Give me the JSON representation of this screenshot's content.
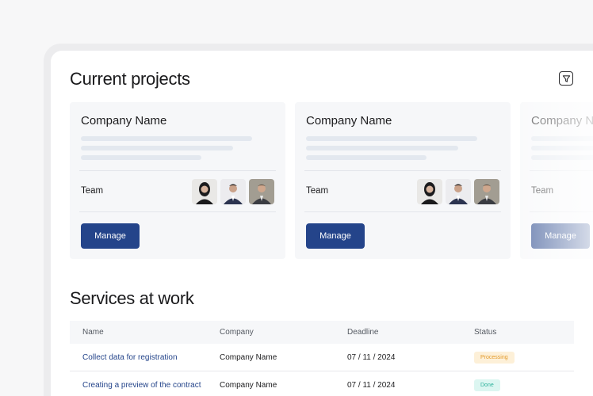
{
  "projects": {
    "title": "Current projects",
    "filter_icon": "filter-icon",
    "cards": [
      {
        "company": "Company Name",
        "team_label": "Team",
        "manage_label": "Manage"
      },
      {
        "company": "Company Name",
        "team_label": "Team",
        "manage_label": "Manage"
      },
      {
        "company": "Company Name",
        "team_label": "Team",
        "manage_label": "Manage"
      }
    ]
  },
  "services": {
    "title": "Services at work",
    "columns": [
      "Name",
      "Company",
      "Deadline",
      "Status"
    ],
    "rows": [
      {
        "name": "Collect data for registration",
        "company": "Company Name",
        "deadline": "07 / 11 / 2024",
        "status": "Processing"
      },
      {
        "name": "Creating a preview of the contract",
        "company": "Company Name",
        "deadline": "07 / 11 / 2024",
        "status": "Done"
      }
    ]
  },
  "colors": {
    "accent": "#24448a",
    "processing": "#e39a2a",
    "done": "#2fb29c"
  }
}
